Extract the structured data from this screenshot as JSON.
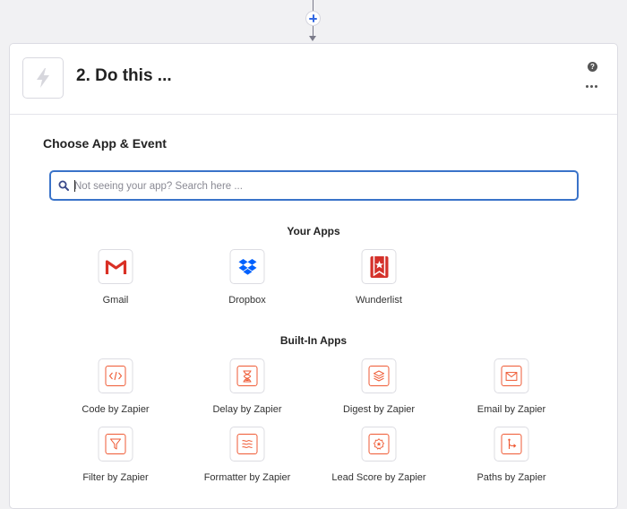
{
  "colors": {
    "accent_blue": "#3167e3",
    "search_border": "#3a73c9",
    "zapier_orange": "#ef5a34",
    "gmail_red": "#d93025",
    "dropbox_blue": "#0061fe",
    "wunderlist_red": "#d4312a"
  },
  "connector": {
    "add_icon": "plus-icon"
  },
  "step": {
    "icon": "lightning-icon",
    "title": "2. Do this ...",
    "help_icon": "question-icon",
    "more_icon": "more-icon"
  },
  "chooser": {
    "title": "Choose App & Event",
    "search_placeholder": "Not seeing your app? Search here ...",
    "search_value": "",
    "your_apps_title": "Your Apps",
    "your_apps": [
      {
        "label": "Gmail",
        "icon": "gmail-icon"
      },
      {
        "label": "Dropbox",
        "icon": "dropbox-icon"
      },
      {
        "label": "Wunderlist",
        "icon": "wunderlist-icon"
      }
    ],
    "builtin_title": "Built-In Apps",
    "builtin_apps": [
      {
        "label": "Code by Zapier",
        "icon": "code-icon"
      },
      {
        "label": "Delay by Zapier",
        "icon": "hourglass-icon"
      },
      {
        "label": "Digest by Zapier",
        "icon": "layers-icon"
      },
      {
        "label": "Email by Zapier",
        "icon": "envelope-icon"
      },
      {
        "label": "Filter by Zapier",
        "icon": "filter-icon"
      },
      {
        "label": "Formatter by Zapier",
        "icon": "formatter-icon"
      },
      {
        "label": "Lead Score by Zapier",
        "icon": "badge-star-icon"
      },
      {
        "label": "Paths by Zapier",
        "icon": "paths-icon"
      }
    ]
  }
}
